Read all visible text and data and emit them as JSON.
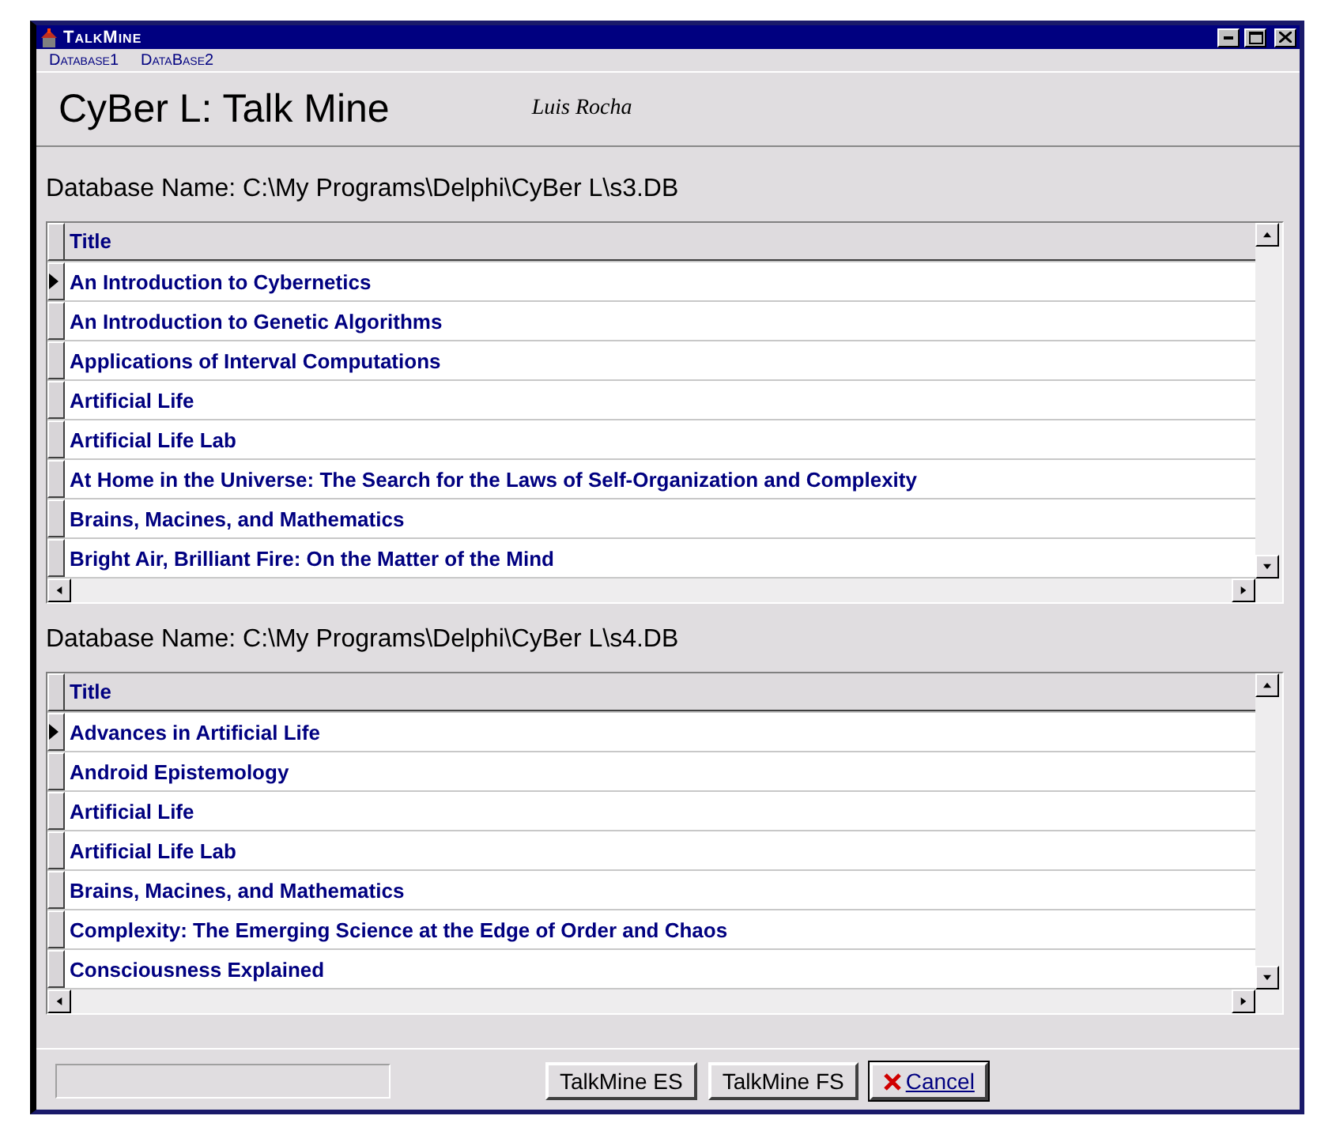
{
  "window": {
    "title": "TalkMine"
  },
  "menu": [
    {
      "label": "Database1"
    },
    {
      "label": "DataBase2"
    }
  ],
  "header": {
    "title": "CyBer L: Talk Mine",
    "author": "Luis Rocha"
  },
  "databases": [
    {
      "label": "Database Name: C:\\My Programs\\Delphi\\CyBer L\\s3.DB",
      "column": "Title",
      "rows": [
        {
          "title": "An Introduction to Cybernetics",
          "selected": true
        },
        {
          "title": "An Introduction to Genetic Algorithms",
          "selected": false
        },
        {
          "title": "Applications of Interval Computations",
          "selected": false
        },
        {
          "title": "Artificial Life",
          "selected": false
        },
        {
          "title": "Artificial Life Lab",
          "selected": false
        },
        {
          "title": "At Home in the Universe: The Search for the Laws of Self-Organization and Complexity",
          "selected": false
        },
        {
          "title": "Brains, Macines, and Mathematics",
          "selected": false
        },
        {
          "title": "Bright Air, Brilliant Fire: On the Matter of the Mind",
          "selected": false
        }
      ]
    },
    {
      "label": "Database Name: C:\\My Programs\\Delphi\\CyBer L\\s4.DB",
      "column": "Title",
      "rows": [
        {
          "title": "Advances in Artificial Life",
          "selected": true
        },
        {
          "title": "Android Epistemology",
          "selected": false
        },
        {
          "title": "Artificial Life",
          "selected": false
        },
        {
          "title": "Artificial Life Lab",
          "selected": false
        },
        {
          "title": "Brains, Macines, and Mathematics",
          "selected": false
        },
        {
          "title": "Complexity: The Emerging Science at the Edge of Order and Chaos",
          "selected": false
        },
        {
          "title": "Consciousness Explained",
          "selected": false
        }
      ]
    }
  ],
  "buttons": [
    {
      "label": "TalkMine ES",
      "kind": "plain"
    },
    {
      "label": "TalkMine FS",
      "kind": "plain"
    },
    {
      "label": "Cancel",
      "kind": "cancel"
    }
  ]
}
